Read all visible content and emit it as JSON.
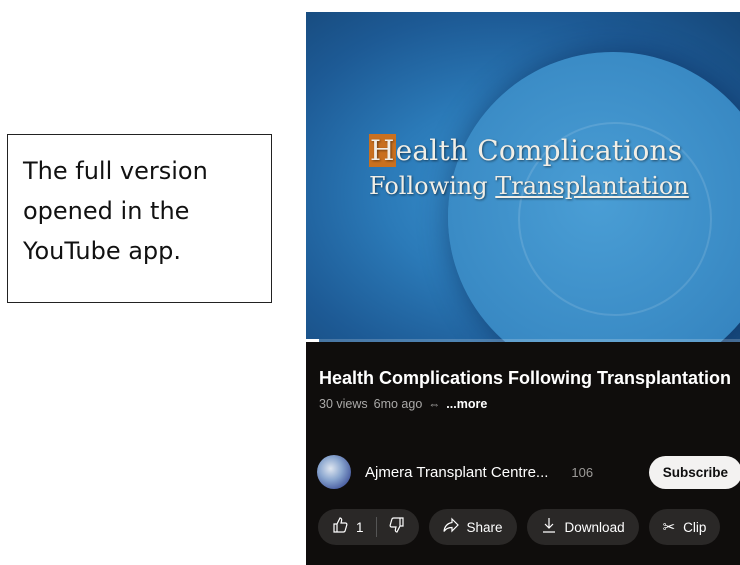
{
  "caption": {
    "lines": [
      "The full version",
      "opened in the",
      "YouTube app."
    ]
  },
  "video": {
    "overlay_title_line1": "Health Complications",
    "overlay_title_line2": "Following Transplantation",
    "progress_fraction": 0.03
  },
  "info": {
    "title": "Health Complications Following Transplantation",
    "views": "30 views",
    "age": "6mo ago",
    "more_label": "...more"
  },
  "channel": {
    "name": "Ajmera Transplant Centre...",
    "subscribers": "106",
    "subscribe_label": "Subscribe"
  },
  "actions": {
    "like_count": "1",
    "share_label": "Share",
    "download_label": "Download",
    "clip_label": "Clip"
  },
  "icons": {
    "like": "thumbs-up-icon",
    "dislike": "thumbs-down-icon",
    "share": "share-arrow-icon",
    "download": "download-icon",
    "clip": "scissors-icon",
    "link": "link-icon"
  },
  "colors": {
    "app_background": "#0f0d0c",
    "pill_background": "#2a2827",
    "subscribe_background": "#f3f2f1",
    "video_blue": "#2b7ab8"
  }
}
